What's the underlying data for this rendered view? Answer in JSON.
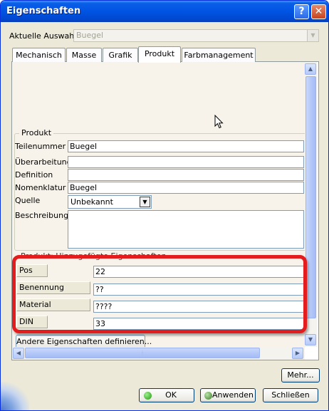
{
  "window": {
    "title": "Eigenschaften"
  },
  "titlebar_buttons": {
    "help": "?",
    "close": "✕"
  },
  "selection": {
    "label": "Aktuelle Auswahl:",
    "value": "Buegel"
  },
  "tabs": [
    {
      "label": "Mechanisch",
      "active": false
    },
    {
      "label": "Masse",
      "active": false
    },
    {
      "label": "Grafik",
      "active": false
    },
    {
      "label": "Produkt",
      "active": true
    },
    {
      "label": "Farbmanagement",
      "active": false
    }
  ],
  "product_section": {
    "legend": "Produkt",
    "fields": [
      {
        "label": "Teilenummer",
        "value": "Buegel"
      },
      {
        "label": "Überarbeitung",
        "value": ""
      },
      {
        "label": "Definition",
        "value": ""
      },
      {
        "label": "Nomenklatur",
        "value": "Buegel"
      },
      {
        "label": "Quelle",
        "value": "Unbekannt"
      },
      {
        "label": "Beschreibung",
        "value": ""
      }
    ]
  },
  "custom_properties": {
    "legend": "Produkt: Hinzugefügte Eigenschaften",
    "rows": [
      {
        "label": "Pos",
        "value": "22"
      },
      {
        "label": "Benennung",
        "value": "??"
      },
      {
        "label": "Material",
        "value": "????"
      },
      {
        "label": "DIN",
        "value": "33"
      }
    ]
  },
  "define_button": "Andere Eigenschaften definieren...",
  "more_button": "Mehr...",
  "footer": {
    "ok": "OK",
    "apply": "Anwenden",
    "close": "Schließen"
  },
  "colors": {
    "highlight": "#e31d1d",
    "title_bar": "#0054e3"
  },
  "icons": {
    "cursor": "mouse-pointer-icon"
  }
}
